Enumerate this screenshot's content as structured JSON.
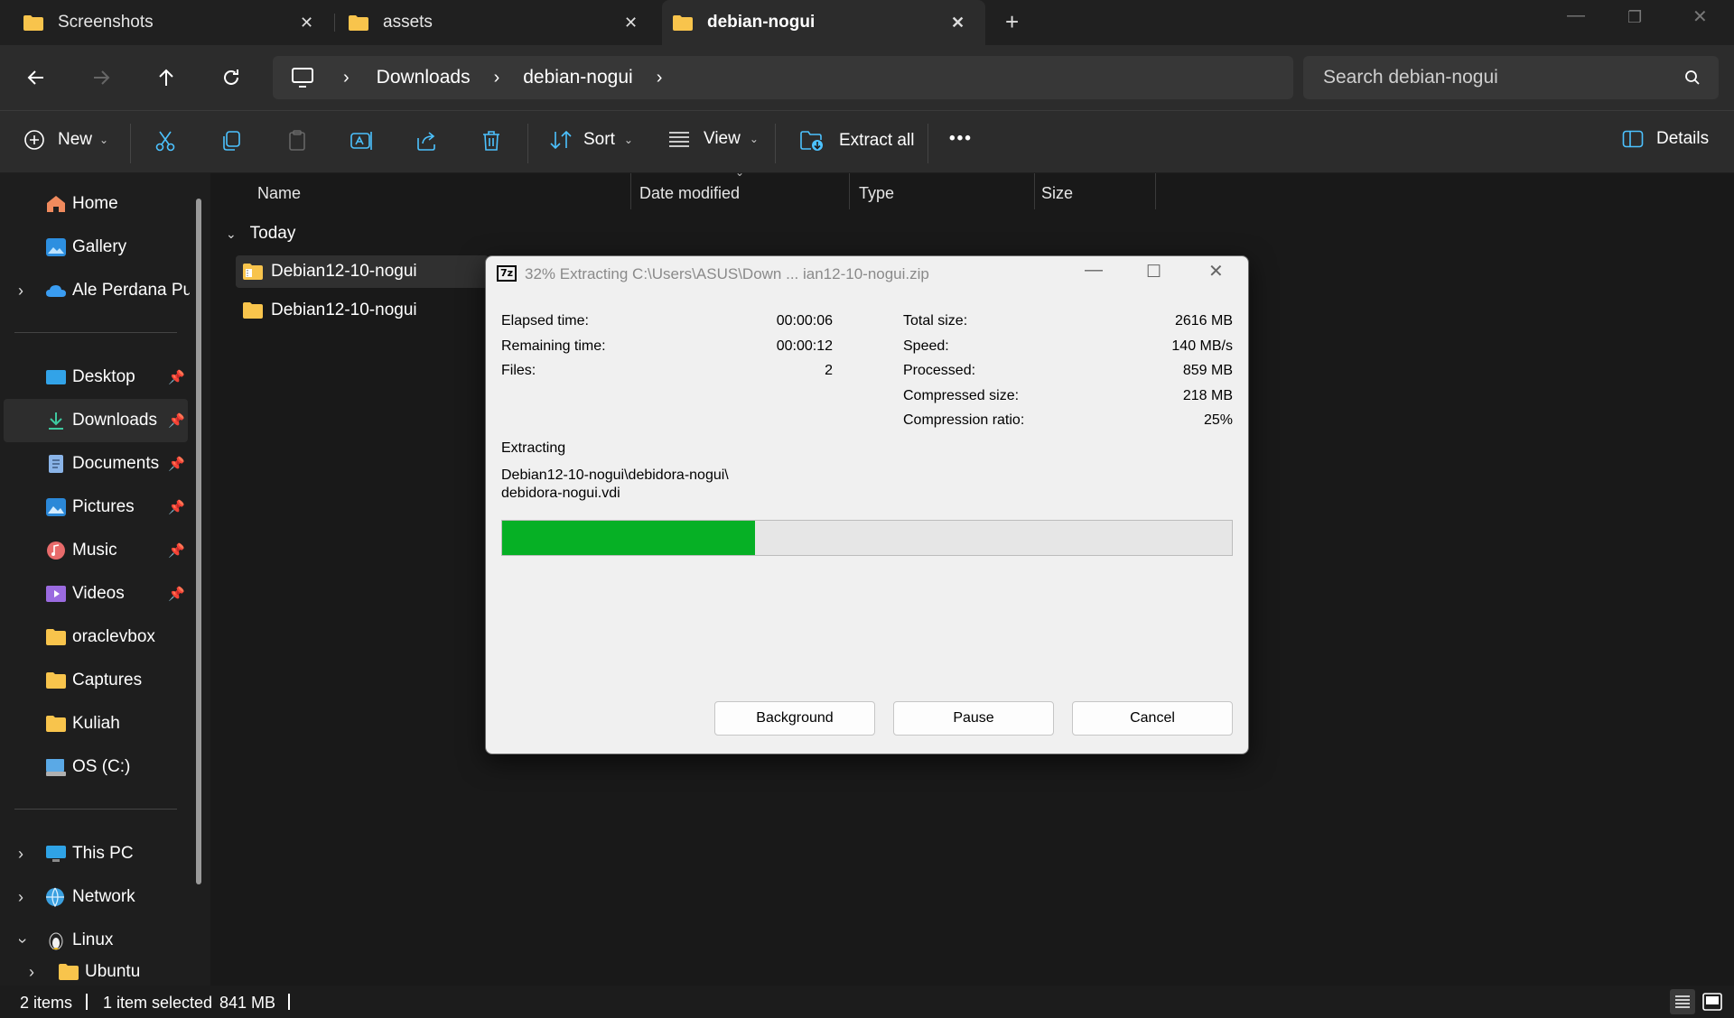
{
  "window": {
    "tabs": [
      {
        "label": "Screenshots"
      },
      {
        "label": "assets"
      },
      {
        "label": "debian-nogui"
      }
    ],
    "new_tab": "+"
  },
  "address": {
    "crumbs": [
      "Downloads",
      "debian-nogui"
    ],
    "search_placeholder": "Search debian-nogui"
  },
  "toolbar": {
    "new_label": "New",
    "sort_label": "Sort",
    "view_label": "View",
    "extract_label": "Extract all",
    "more_label": "•••",
    "details_label": "Details"
  },
  "sidebar": {
    "items": [
      {
        "label": "Home"
      },
      {
        "label": "Gallery"
      },
      {
        "label": "Ale Perdana Putra"
      },
      {
        "label": "Desktop"
      },
      {
        "label": "Downloads"
      },
      {
        "label": "Documents"
      },
      {
        "label": "Pictures"
      },
      {
        "label": "Music"
      },
      {
        "label": "Videos"
      },
      {
        "label": "oraclevbox"
      },
      {
        "label": "Captures"
      },
      {
        "label": "Kuliah"
      },
      {
        "label": "OS (C:)"
      },
      {
        "label": "This PC"
      },
      {
        "label": "Network"
      },
      {
        "label": "Linux"
      },
      {
        "label": "Ubuntu"
      }
    ]
  },
  "list": {
    "columns": [
      "Name",
      "Date modified",
      "Type",
      "Size"
    ],
    "group": "Today",
    "rows": [
      {
        "name": "Debian12-10-nogui"
      },
      {
        "name": "Debian12-10-nogui"
      }
    ]
  },
  "status": {
    "items": "2 items",
    "selected": "1 item selected",
    "size": "841 MB"
  },
  "dialog": {
    "title": "32% Extracting C:\\Users\\ASUS\\Down ... ian12-10-nogui.zip",
    "left_stats": [
      {
        "label": "Elapsed time:",
        "value": "00:00:06"
      },
      {
        "label": "Remaining time:",
        "value": "00:00:12"
      },
      {
        "label": "Files:",
        "value": "2"
      }
    ],
    "right_stats": [
      {
        "label": "Total size:",
        "value": "2616 MB"
      },
      {
        "label": "Speed:",
        "value": "140 MB/s"
      },
      {
        "label": "Processed:",
        "value": "859 MB"
      },
      {
        "label": "Compressed size:",
        "value": "218 MB"
      },
      {
        "label": "Compression ratio:",
        "value": "25%"
      }
    ],
    "action": "Extracting",
    "path_line1": "Debian12-10-nogui\\debidora-nogui\\",
    "path_line2": "debidora-nogui.vdi",
    "progress": 0.347,
    "buttons": {
      "background": "Background",
      "pause": "Pause",
      "cancel": "Cancel"
    }
  },
  "colors": {
    "progress_fill": "#06b025",
    "folder": "#f8c44c",
    "accent": "#4cc2ff"
  }
}
